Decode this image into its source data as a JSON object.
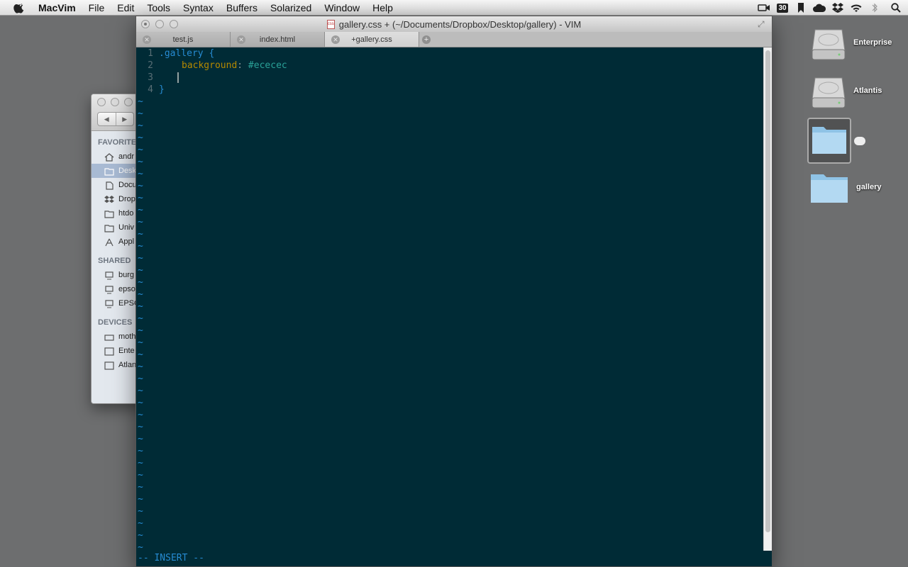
{
  "menubar": {
    "apple_icon": "apple-logo-icon",
    "app_name": "MacVim",
    "items": [
      "File",
      "Edit",
      "Tools",
      "Syntax",
      "Buffers",
      "Solarized",
      "Window",
      "Help"
    ],
    "calendar_day": "30"
  },
  "desktop": {
    "icons": [
      {
        "label": "Enterprise",
        "kind": "hard-drive"
      },
      {
        "label": "Atlantis",
        "kind": "hard-drive"
      },
      {
        "label": "",
        "kind": "folder"
      },
      {
        "label": "gallery",
        "kind": "folder"
      }
    ]
  },
  "finder": {
    "sections": [
      {
        "title": "FAVORITES",
        "items": [
          "andr",
          "Desk",
          "Docu",
          "Drop",
          "htdo",
          "Univ",
          "Appl"
        ]
      },
      {
        "title": "SHARED",
        "items": [
          "burg",
          "epso",
          "EPSO"
        ]
      },
      {
        "title": "DEVICES",
        "items": [
          "moth",
          "Ente",
          "Atlan"
        ]
      }
    ],
    "selected_item": "Desk"
  },
  "vim": {
    "title": "gallery.css + (~/Documents/Dropbox/Desktop/gallery) - VIM",
    "tabs": [
      {
        "label": "test.js",
        "active": false
      },
      {
        "label": "index.html",
        "active": false
      },
      {
        "label": "+gallery.css",
        "active": true
      }
    ],
    "lines": [
      {
        "num": "1",
        "selector": ".gallery",
        "brace_open": " {"
      },
      {
        "num": "2",
        "property": "background",
        "colon": ":",
        "value": " #ececec"
      },
      {
        "num": "3"
      },
      {
        "num": "4",
        "brace_close": "}"
      }
    ],
    "tilde": "~",
    "mode": "-- INSERT --"
  },
  "colors": {
    "background": "#002b36",
    "blue": "#268bd2",
    "yellow": "#b58900",
    "cyan": "#2aa198",
    "line_number": "#586e75"
  }
}
